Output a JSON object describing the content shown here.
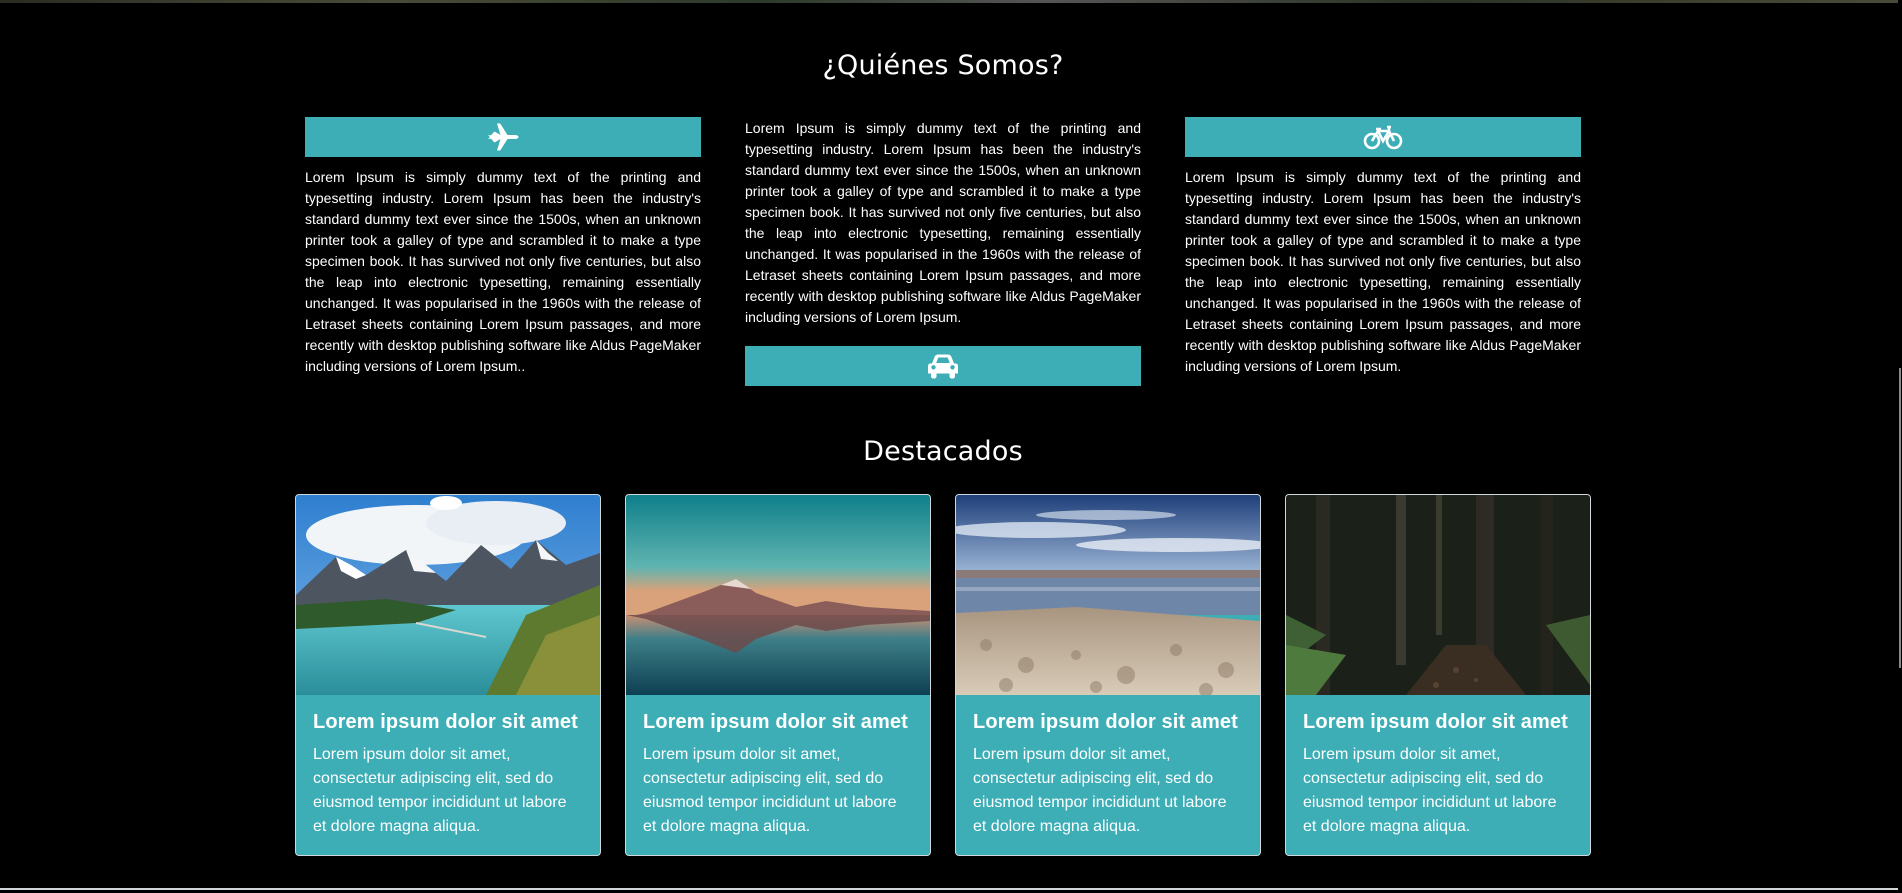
{
  "about": {
    "title": "¿Quiénes Somos?",
    "columns": [
      {
        "icon": "plane-icon",
        "text": "Lorem Ipsum is simply dummy text of the printing and typesetting industry. Lorem Ipsum has been the industry's standard dummy text ever since the 1500s, when an unknown printer took a galley of type and scrambled it to make a type specimen book. It has survived not only five centuries, but also the leap into electronic typesetting, remaining essentially unchanged. It was popularised in the 1960s with the release of Letraset sheets containing Lorem Ipsum passages, and more recently with desktop publishing software like Aldus PageMaker including versions of Lorem Ipsum.."
      },
      {
        "icon": "car-icon",
        "text": "Lorem Ipsum is simply dummy text of the printing and typesetting industry. Lorem Ipsum has been the industry's standard dummy text ever since the 1500s, when an unknown printer took a galley of type and scrambled it to make a type specimen book. It has survived not only five centuries, but also the leap into electronic typesetting, remaining essentially unchanged. It was popularised in the 1960s with the release of Letraset sheets containing Lorem Ipsum passages, and more recently with desktop publishing software like Aldus PageMaker including versions of Lorem Ipsum."
      },
      {
        "icon": "bicycle-icon",
        "text": "Lorem Ipsum is simply dummy text of the printing and typesetting industry. Lorem Ipsum has been the industry's standard dummy text ever since the 1500s, when an unknown printer took a galley of type and scrambled it to make a type specimen book. It has survived not only five centuries, but also the leap into electronic typesetting, remaining essentially unchanged. It was popularised in the 1960s with the release of Letraset sheets containing Lorem Ipsum passages, and more recently with desktop publishing software like Aldus PageMaker including versions of Lorem Ipsum."
      }
    ]
  },
  "featured": {
    "title": "Destacados",
    "cards": [
      {
        "image": "mountain-lake-photo",
        "title": "Lorem ipsum dolor sit amet",
        "text": "Lorem ipsum dolor sit amet, consectetur adipiscing elit, sed do eiusmod tempor incididunt ut labore et dolore magna aliqua."
      },
      {
        "image": "volcano-reflection-photo",
        "title": "Lorem ipsum dolor sit amet",
        "text": "Lorem ipsum dolor sit amet, consectetur adipiscing elit, sed do eiusmod tempor incididunt ut labore et dolore magna aliqua."
      },
      {
        "image": "salt-flat-photo",
        "title": "Lorem ipsum dolor sit amet",
        "text": "Lorem ipsum dolor sit amet, consectetur adipiscing elit, sed do eiusmod tempor incididunt ut labore et dolore magna aliqua."
      },
      {
        "image": "forest-path-photo",
        "title": "Lorem ipsum dolor sit amet",
        "text": "Lorem ipsum dolor sit amet, consectetur adipiscing elit, sed do eiusmod tempor incididunt ut labore et dolore magna aliqua."
      }
    ]
  },
  "colors": {
    "accent": "#3eaeb6",
    "background": "#000000",
    "text": "#ffffff"
  }
}
